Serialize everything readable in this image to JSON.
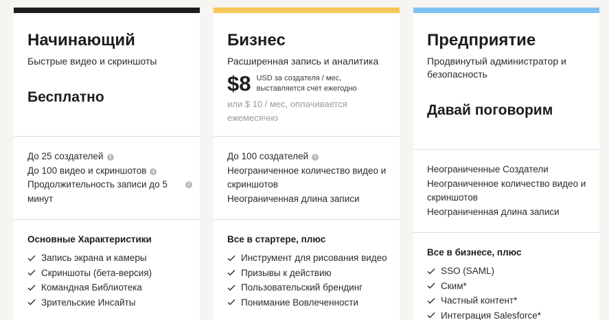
{
  "colors": {
    "starter_bar": "#1d1d1d",
    "business_bar": "#f7c65a",
    "enterprise_bar": "#7ec1f2"
  },
  "icons": {
    "info": "info-circle-icon",
    "check": "check-icon"
  },
  "plans": [
    {
      "title": "Начинающий",
      "subtitle": "Быстрые видео и скриншоты",
      "price": "Бесплатно",
      "limits": [
        {
          "text": "До 25 создателей",
          "info": true
        },
        {
          "text": "До 100 видео и скриншотов",
          "info": true
        },
        {
          "text": "Продолжительность записи до 5 минут",
          "info": true
        }
      ],
      "features_heading": "Основные Характеристики",
      "features": [
        "Запись экрана и камеры",
        "Скриншоты (бета-версия)",
        "Командная Библиотека",
        "Зрительские Инсайты"
      ]
    },
    {
      "title": "Бизнес",
      "subtitle": "Расширенная запись и аналитика",
      "price": "$8",
      "price_note": "USD за создателя / мес, выставляется счет ежегодно",
      "alt_price": "или $ 10 / мес, оплачивается ежемесячно",
      "limits": [
        {
          "text": "До 100 создателей",
          "info": true
        },
        {
          "text": "Неограниченное количество видео и скриншотов",
          "info": false
        },
        {
          "text": "Неограниченная длина записи",
          "info": false
        }
      ],
      "features_heading": "Все в стартере, плюс",
      "features": [
        "Инструмент для рисования видео",
        "Призывы к действию",
        "Пользовательский брендинг",
        "Понимание Вовлеченности"
      ]
    },
    {
      "title": "Предприятие",
      "subtitle": "Продвинутый администратор и безопасность",
      "price": "Давай поговорим",
      "limits": [
        {
          "text": "Неограниченные Создатели",
          "info": false
        },
        {
          "text": "Неограниченное количество видео и скриншотов",
          "info": false
        },
        {
          "text": "Неограниченная длина записи",
          "info": false
        }
      ],
      "features_heading": "Все в бизнесе, плюс",
      "features": [
        "SSO (SAML)",
        "Ским*",
        "Частный контент*",
        "Интеграция Salesforce*"
      ]
    }
  ]
}
